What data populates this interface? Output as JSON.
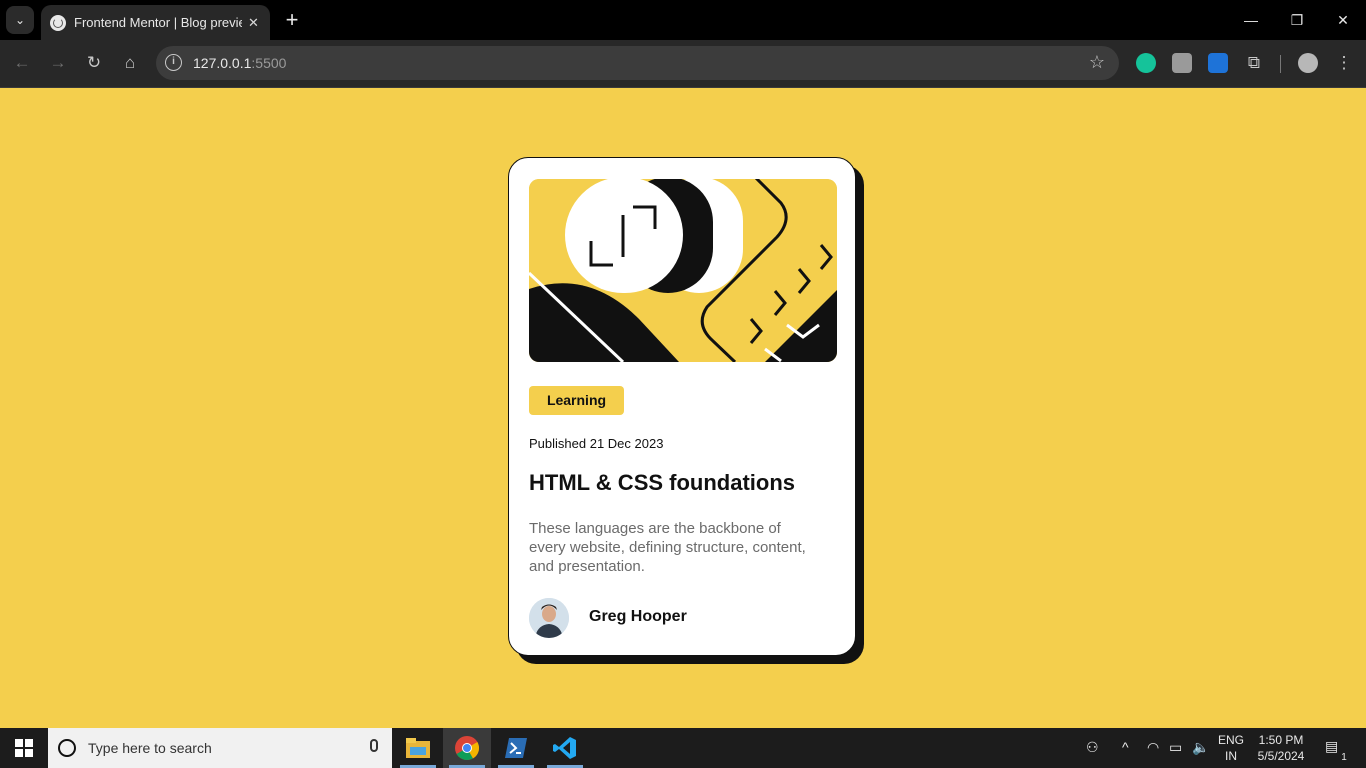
{
  "browser": {
    "tab_title": "Frontend Mentor | Blog preview",
    "tab_close": "✕",
    "new_tab": "+",
    "url_host": "127.0.0.1",
    "url_port": ":5500"
  },
  "card": {
    "category": "Learning",
    "published": "Published 21 Dec 2023",
    "title": "HTML & CSS foundations",
    "description": "These languages are the backbone of every website, defining structure, content, and presentation.",
    "author": "Greg Hooper"
  },
  "taskbar": {
    "search_placeholder": "Type here to search",
    "lang_line1": "ENG",
    "lang_line2": "IN",
    "time": "1:50 PM",
    "date": "5/5/2024",
    "notification_count": "1"
  },
  "colors": {
    "page_background": "#f4cf4d",
    "card_background": "#ffffff",
    "text_dark": "#111111",
    "text_muted": "#6b6b6b"
  }
}
